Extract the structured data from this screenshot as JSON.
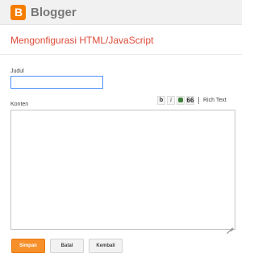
{
  "brand": {
    "logo_letter": "B",
    "name": "Blogger",
    "accent": "#f57d00"
  },
  "dialog": {
    "title": "Mengonfigurasi HTML/JavaScript",
    "title_color": "#dd4b39"
  },
  "form": {
    "title_label": "Judul",
    "title_value": "",
    "content_label": "Konten",
    "content_value": ""
  },
  "toolbar": {
    "bold": "b",
    "italic": "i",
    "image_icon": "image-icon",
    "quote": "66",
    "rich_text": "Rich Text"
  },
  "buttons": {
    "save": "Simpan",
    "cancel": "Batal",
    "back": "Kembali"
  }
}
